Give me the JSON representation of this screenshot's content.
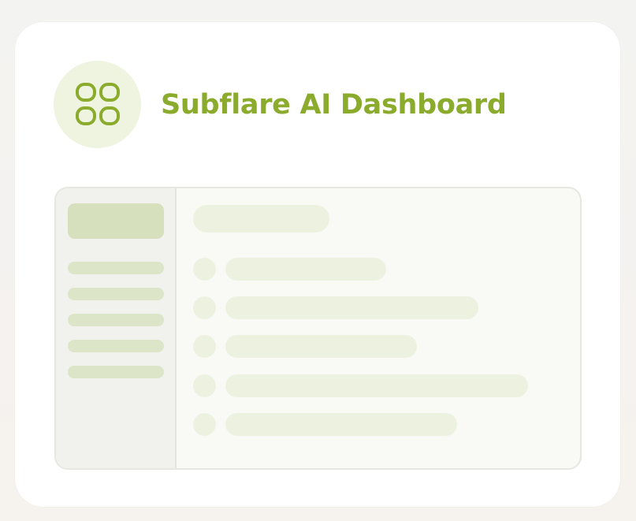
{
  "app": {
    "title": "Subflare AI Dashboard",
    "logo_icon": "grid-icon",
    "accent_color": "#8aab2c",
    "logo_bg_color": "#eff4e1"
  },
  "preview": {
    "sidebar_items_count": 5,
    "content_rows_count": 5
  }
}
